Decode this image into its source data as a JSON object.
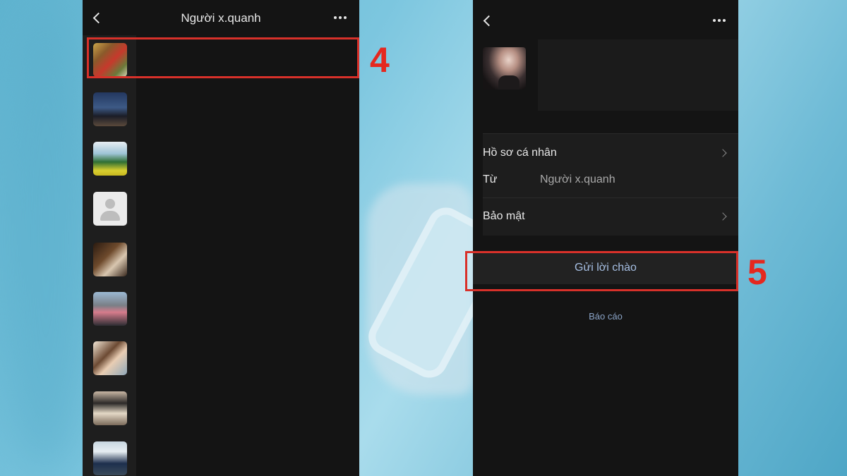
{
  "left_screen": {
    "title": "Người x.quanh",
    "avatars": [
      "avatar-1",
      "avatar-2",
      "avatar-3",
      "avatar-default",
      "avatar-5",
      "avatar-6",
      "avatar-7",
      "avatar-8",
      "avatar-9"
    ]
  },
  "right_screen": {
    "rows": {
      "profile_label": "Hồ sơ cá nhân",
      "from_label": "Từ",
      "from_value": "Người x.quanh",
      "security_label": "Bảo mật"
    },
    "greet_button": "Gửi lời chào",
    "report_link": "Báo cáo"
  },
  "annotations": {
    "step4": "4",
    "step5": "5"
  },
  "colors": {
    "highlight": "#d8312a",
    "step_number": "#e5281f",
    "greet_text": "#a6bfe3"
  },
  "icons": [
    "back-icon",
    "more-icon",
    "chevron-right-icon",
    "user-silhouette-icon"
  ]
}
